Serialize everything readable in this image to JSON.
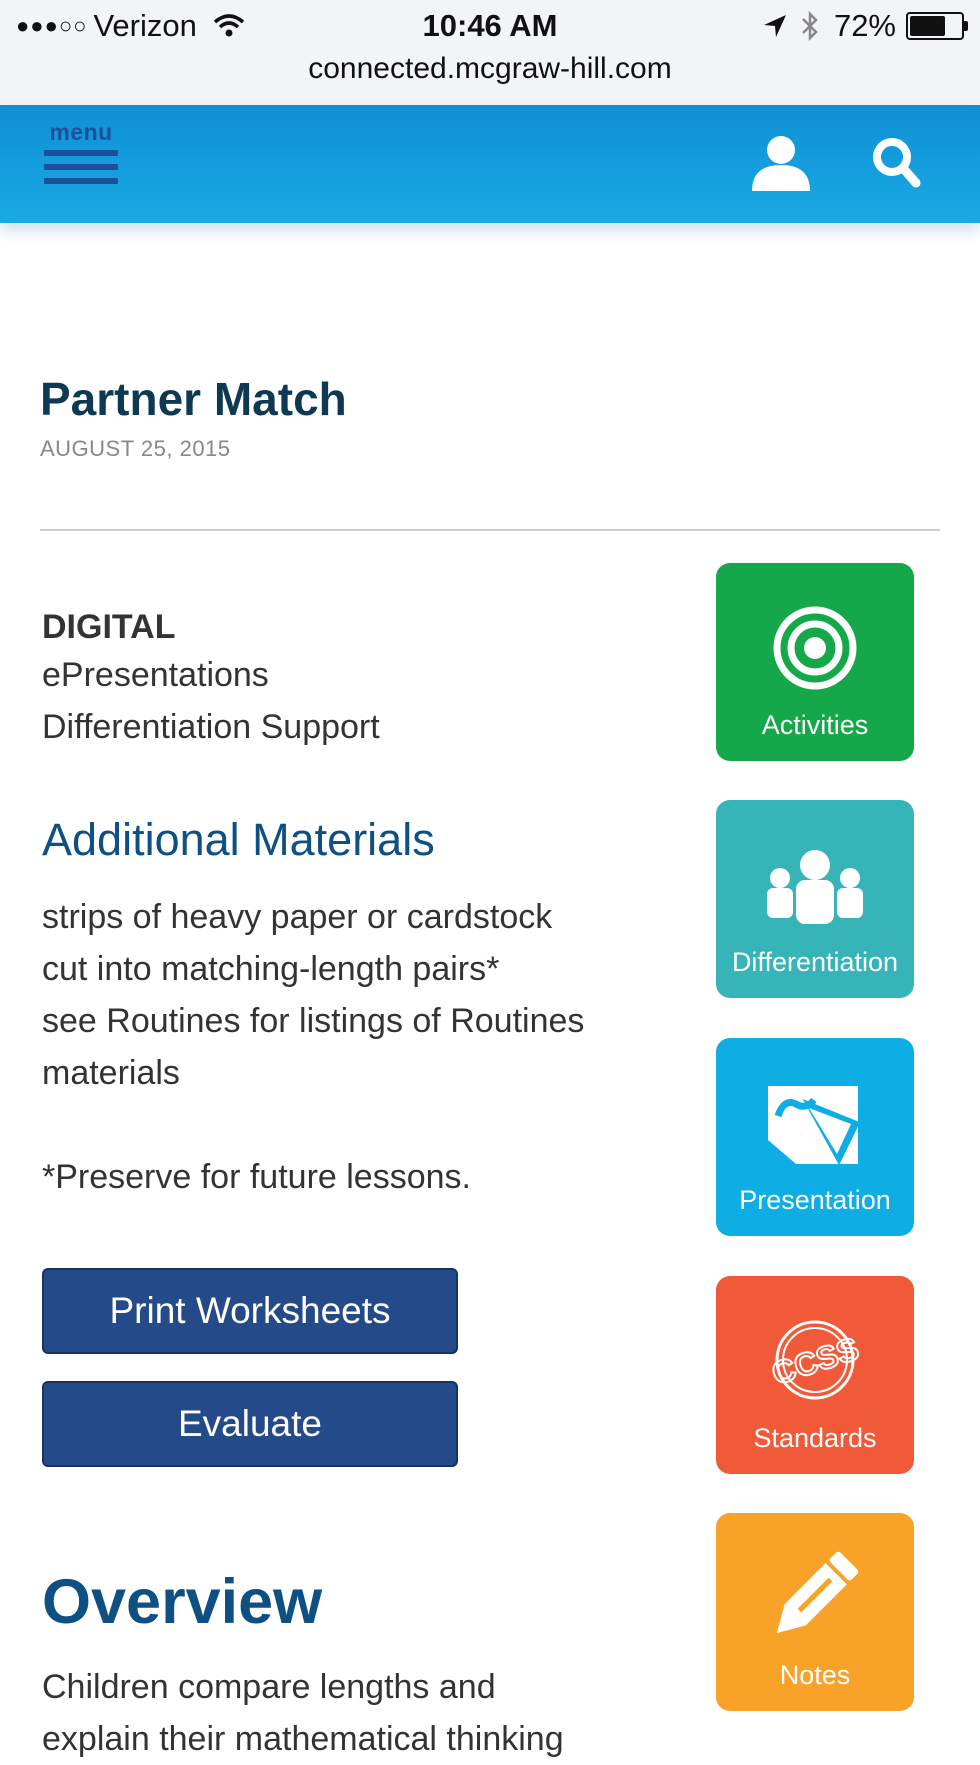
{
  "status_bar": {
    "signal": "●●●○○",
    "carrier": "Verizon",
    "time": "10:46 AM",
    "battery_percent": "72%",
    "battery_level": 0.72
  },
  "browser": {
    "url": "connected.mcgraw-hill.com"
  },
  "nav": {
    "menu_label": "menu"
  },
  "article": {
    "title": "Partner Match",
    "date": "AUGUST 25, 2015"
  },
  "digital": {
    "heading": "DIGITAL",
    "items": [
      "ePresentations",
      "Differentiation Support"
    ]
  },
  "additional_materials": {
    "heading": "Additional Materials",
    "lines": [
      "strips of heavy paper or cardstock",
      "cut into matching-length pairs*",
      "see Routines for listings of Routines",
      "materials"
    ],
    "note": "*Preserve for future lessons."
  },
  "buttons": {
    "print": "Print Worksheets",
    "evaluate": "Evaluate"
  },
  "overview": {
    "heading": "Overview",
    "lines": [
      "Children compare lengths and",
      "explain their mathematical thinking"
    ]
  },
  "tiles": [
    {
      "label": "Activities",
      "color": "#15a84a",
      "icon": "target-icon"
    },
    {
      "label": "Differentiation",
      "color": "#36b4b8",
      "icon": "group-icon"
    },
    {
      "label": "Presentation",
      "color": "#0eaee5",
      "icon": "presentation-icon"
    },
    {
      "label": "Standards",
      "color": "#f05a38",
      "icon": "ccss-icon"
    },
    {
      "label": "Notes",
      "color": "#f8a227",
      "icon": "pencil-icon"
    }
  ]
}
